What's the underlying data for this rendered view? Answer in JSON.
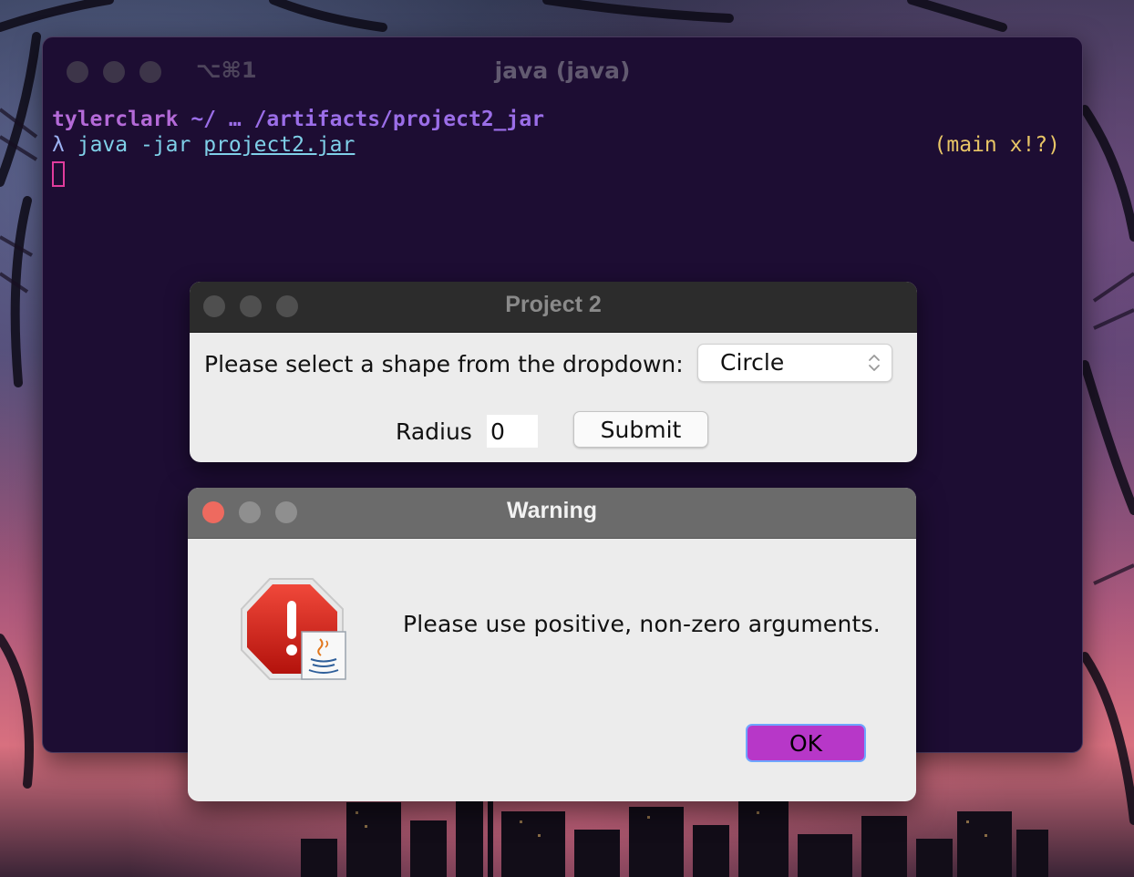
{
  "terminal": {
    "shortcut": "⌥⌘1",
    "title": "java (java)",
    "prompt_user": "tylerclark",
    "prompt_path": " ~/ … /artifacts/project2_jar",
    "lambda": "λ",
    "command": "java -jar",
    "command_arg": "project2.jar",
    "git_status": "(main x!?)"
  },
  "project_window": {
    "title": "Project 2",
    "prompt_label": "Please select a shape from the dropdown:",
    "shape_selected": "Circle",
    "radius_label": "Radius",
    "radius_value": "0",
    "submit_label": "Submit"
  },
  "warning_dialog": {
    "title": "Warning",
    "message": "Please use positive, non-zero arguments.",
    "ok_label": "OK"
  },
  "colors": {
    "terminal_bg": "#1d0d33",
    "prompt_user": "#b46ad8",
    "git_status": "#e8c566",
    "ok_button": "#b737c8",
    "close_button": "#ee6a5f"
  },
  "icons": [
    "stop-warning-icon",
    "java-cup-icon",
    "up-down-chevron-icon"
  ]
}
